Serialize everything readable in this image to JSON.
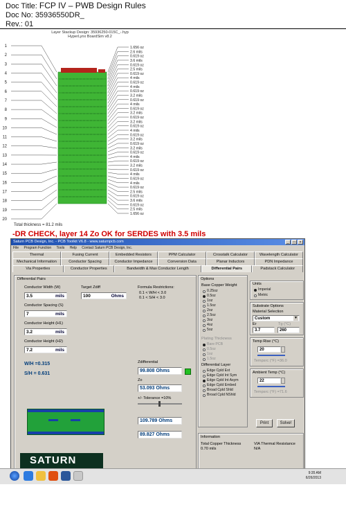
{
  "header": {
    "doc_title_label": "Doc Title:",
    "doc_title_value": "FCP IV – PWB Design Rules",
    "doc_no_label": "Doc No:",
    "doc_no_value": "35936550DR_",
    "rev_label": "Rev.:",
    "rev_value": "01"
  },
  "stackup": {
    "title_line1": "Layer Stackup  Design: 35936250-015C_-.hyp",
    "title_line2": "HyperLynx BoardSim v8.2",
    "layer_numbers": [
      "1",
      "2",
      "3",
      "4",
      "5",
      "6",
      "7",
      "8",
      "9",
      "10",
      "11",
      "12",
      "13",
      "14",
      "15",
      "16",
      "17",
      "18",
      "19",
      "20"
    ],
    "right_labels": [
      "1.656 oz",
      "2.6 mils",
      "0.619 oz",
      "3.6 mils",
      "0.619 oz",
      "2.5 mils",
      "0.619 oz",
      "4 mils",
      "0.619 oz",
      "4 mils",
      "0.619 oz",
      "3.2 mils",
      "0.619 oz",
      "4 mils",
      "0.619 oz",
      "3.2 mils",
      "0.619 oz",
      "3.2 mils",
      "0.619 oz",
      "4 mils",
      "0.619 oz",
      "3.2 mils",
      "0.619 oz",
      "3.2 mils",
      "0.619 oz",
      "4 mils",
      "0.619 oz",
      "3.2 mils",
      "0.619 oz",
      "4 mils",
      "0.619 oz",
      "4 mils",
      "0.619 oz",
      "2.5 mils",
      "0.619 oz",
      "3.6 mils",
      "0.619 oz",
      "2.5 mils",
      "1.656 oz"
    ],
    "total": "Total thickness = 81.2 mils",
    "colors": {
      "green": "#3fb535",
      "green_dark": "#2b8f2a",
      "red": "#b4241c"
    }
  },
  "dr_check": "-DR CHECK, layer 14 Zo  OK for SERDES with 3.5 mils",
  "app": {
    "title": "Saturn PCB Design, Inc. - PCB Toolkit V6.8 - www.saturnpcb.com",
    "menu": [
      "File",
      "Program Function",
      "Tools",
      "Help",
      "Contact Saturn PCB Design, Inc."
    ],
    "tabs_row1": [
      "Thermal",
      "Fusing Current",
      "Embedded Resistors",
      "PPM Calculator",
      "Crosstalk Calculator",
      "Wavelength Calculator"
    ],
    "tabs_row2": [
      "Mechanical Information",
      "Conductor Spacing",
      "Conductor Impedance",
      "Conversion Data",
      "Planar Inductors",
      "PDN Impedance"
    ],
    "tabs_row3": [
      "Via Properties",
      "Conductor Properties",
      "Bandwidth & Max Conductor Length",
      "Differential Pairs",
      "Padstack Calculator"
    ],
    "diff_pairs": {
      "group_title": "Differential Pairs",
      "conductor_width_label": "Conductor Width (W)",
      "conductor_width_value": "3.5",
      "conductor_width_unit": "mils",
      "target_zdiff_label": "Target Zdiff",
      "target_zdiff_value": "100",
      "target_zdiff_unit": "Ohms",
      "formula_label": "Formula Restrictions:",
      "formula_line1": "0.1 < W/H < 3.0",
      "formula_line2": "0.1 < S/H < 3.0",
      "spacing_label": "Conductor Spacing (S)",
      "spacing_value": "7",
      "spacing_unit": "mils",
      "height1_label": "Conductor Height (H1)",
      "height1_value": "3.2",
      "height1_unit": "mils",
      "height2_label": "Conductor Height (H2)",
      "height2_value": "7.2",
      "height2_unit": "mils",
      "wh_ratio": "W/H =0.315",
      "sh_ratio": "S/H = 0.631",
      "zdiff_label": "Zdifferential",
      "zdiff_value": "99.808 Ohms",
      "zo_label": "Zo",
      "zo_value": "53.093 Ohms",
      "tolerance_label": "+/- Tolerance =10%",
      "tol_high": "109.789 Ohms",
      "tol_low": "89.827 Ohms"
    },
    "options": {
      "title": "Options",
      "base_copper_label": "Base Copper Weight",
      "base_copper_items": [
        "0.25oz",
        "0.5oz",
        "1oz",
        "1.5oz",
        "2oz",
        "2.5oz",
        "3oz",
        "4oz",
        "5oz"
      ],
      "base_copper_selected": 1,
      "plating_label": "Plating Thickness",
      "plating_items": [
        "Bare PCB",
        "0.5oz",
        "1oz",
        "1.5oz"
      ],
      "diff_layer_label": "Differential Layer",
      "diff_layer_items": [
        "Edge Cpld Ext",
        "Edge Cpld Int Sym",
        "Edge Cpld Int Asym",
        "Edge Cpld Embed",
        "Broad Cpld Shld",
        "Broad Cpld NShld"
      ],
      "diff_layer_selected": 2
    },
    "units": {
      "title": "Units",
      "imperial": "Imperial",
      "metric": "Metric"
    },
    "substrate": {
      "title": "Substrate Options",
      "material_label": "Material Selection",
      "material_value": "Custom",
      "er_label": "Er",
      "tg_label": "Tg (°C)",
      "er_value": "3.7",
      "tg_value": "260"
    },
    "temp_rise": {
      "title": "Temp Rise (°C)",
      "value": "20",
      "readout": "Tempsrc (°F) =36.0"
    },
    "ambient": {
      "title": "Ambient Temp (°C)",
      "value": "22",
      "readout": "Tempsrc (°F) =71.6"
    },
    "print_label": "Print",
    "solve_label": "Solve!",
    "info": {
      "title": "Information",
      "total_copper_label": "Total Copper Thickness",
      "total_copper_value": "0.70 mils",
      "via_thermal_label": "VIA Thermal Resistance",
      "via_thermal_value": "N/A"
    },
    "logo_text": "SATURN"
  },
  "taskbar": {
    "time": "9:35 AM",
    "date": "6/26/2013"
  }
}
